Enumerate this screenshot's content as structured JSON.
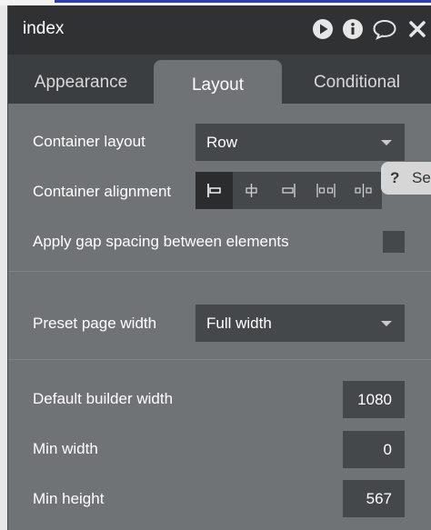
{
  "window": {
    "title": "index",
    "icons": [
      "play-icon",
      "info-icon",
      "comment-icon",
      "close-icon"
    ]
  },
  "tabs": [
    {
      "label": "Appearance",
      "active": false
    },
    {
      "label": "Layout",
      "active": true
    },
    {
      "label": "Conditional",
      "active": false
    }
  ],
  "layout": {
    "container_layout_label": "Container layout",
    "container_layout_value": "Row",
    "container_alignment_label": "Container alignment",
    "alignment_options": [
      "align-left-icon",
      "align-center-icon",
      "align-right-icon",
      "space-between-icon",
      "space-around-icon"
    ],
    "gap_label": "Apply gap spacing between elements",
    "gap_checked": false,
    "preset_label": "Preset page width",
    "preset_value": "Full width",
    "default_width_label": "Default builder width",
    "default_width_value": "1080",
    "min_width_label": "Min width",
    "min_width_value": "0",
    "min_height_label": "Min height",
    "min_height_value": "567"
  },
  "help_tip": {
    "text": "Se"
  },
  "colors": {
    "panel_bg": "#6f7376",
    "titlebar_bg": "#2f3133",
    "tabs_bg": "#3b3e41",
    "field_bg": "#45484b",
    "active_align_bg": "#2a2c2e"
  }
}
